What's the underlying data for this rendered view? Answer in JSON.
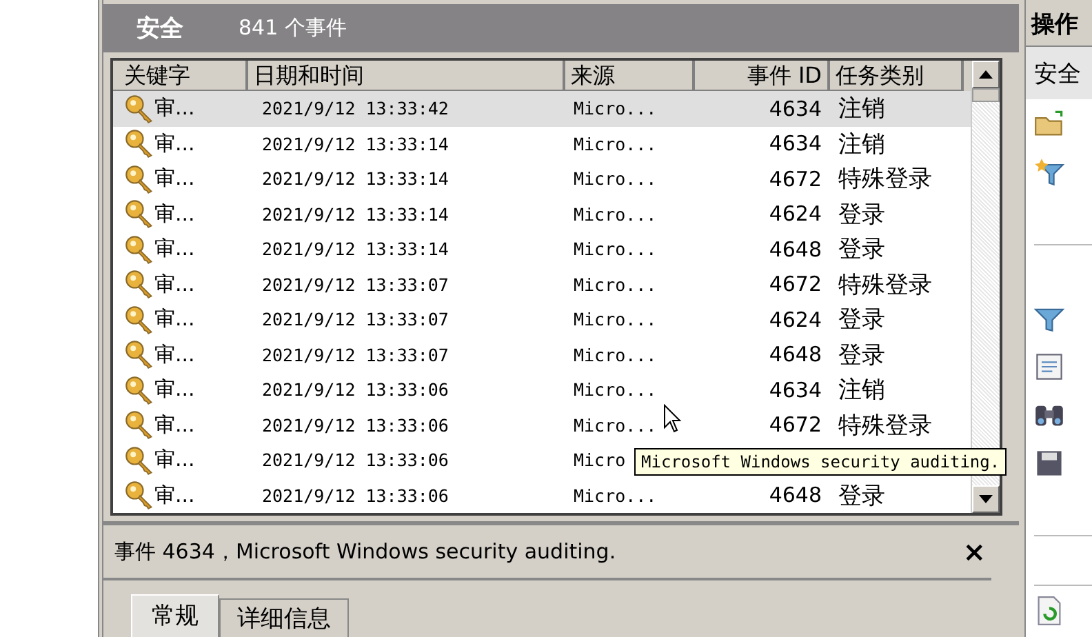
{
  "header": {
    "title": "安全",
    "count": "841 个事件"
  },
  "table": {
    "columns": [
      "关键字",
      "日期和时间",
      "来源",
      "事件 ID",
      "任务类别"
    ],
    "rows": [
      {
        "keyword": "审...",
        "datetime": "2021/9/12 13:33:42",
        "source": "Micro...",
        "event_id": "4634",
        "task": "注销",
        "selected": true
      },
      {
        "keyword": "审...",
        "datetime": "2021/9/12 13:33:14",
        "source": "Micro...",
        "event_id": "4634",
        "task": "注销",
        "selected": false
      },
      {
        "keyword": "审...",
        "datetime": "2021/9/12 13:33:14",
        "source": "Micro...",
        "event_id": "4672",
        "task": "特殊登录",
        "selected": false
      },
      {
        "keyword": "审...",
        "datetime": "2021/9/12 13:33:14",
        "source": "Micro...",
        "event_id": "4624",
        "task": "登录",
        "selected": false
      },
      {
        "keyword": "审...",
        "datetime": "2021/9/12 13:33:14",
        "source": "Micro...",
        "event_id": "4648",
        "task": "登录",
        "selected": false
      },
      {
        "keyword": "审...",
        "datetime": "2021/9/12 13:33:07",
        "source": "Micro...",
        "event_id": "4672",
        "task": "特殊登录",
        "selected": false
      },
      {
        "keyword": "审...",
        "datetime": "2021/9/12 13:33:07",
        "source": "Micro...",
        "event_id": "4624",
        "task": "登录",
        "selected": false
      },
      {
        "keyword": "审...",
        "datetime": "2021/9/12 13:33:07",
        "source": "Micro...",
        "event_id": "4648",
        "task": "登录",
        "selected": false
      },
      {
        "keyword": "审...",
        "datetime": "2021/9/12 13:33:06",
        "source": "Micro...",
        "event_id": "4634",
        "task": "注销",
        "selected": false
      },
      {
        "keyword": "审...",
        "datetime": "2021/9/12 13:33:06",
        "source": "Micro...",
        "event_id": "4672",
        "task": "特殊登录",
        "selected": false
      },
      {
        "keyword": "审...",
        "datetime": "2021/9/12 13:33:06",
        "source": "Micro",
        "event_id": "",
        "task": "",
        "selected": false
      },
      {
        "keyword": "审...",
        "datetime": "2021/9/12 13:33:06",
        "source": "Micro...",
        "event_id": "4648",
        "task": "登录",
        "selected": false
      }
    ]
  },
  "tooltip": "Microsoft Windows security auditing.",
  "details": {
    "title": "事件 4634，Microsoft Windows security auditing.",
    "close": "×",
    "tabs": [
      {
        "label": "常规",
        "selected": true
      },
      {
        "label": "详细信息",
        "selected": false
      }
    ]
  },
  "actions": {
    "title": "操作",
    "section": "安全",
    "items": [
      {
        "kind": "folder"
      },
      {
        "kind": "filter-star"
      },
      {
        "kind": "blank"
      },
      {
        "kind": "divider"
      },
      {
        "kind": "blank"
      },
      {
        "kind": "filter"
      },
      {
        "kind": "properties"
      },
      {
        "kind": "binoculars"
      },
      {
        "kind": "disk"
      },
      {
        "kind": "blank"
      },
      {
        "kind": "divider"
      },
      {
        "kind": "blank"
      },
      {
        "kind": "divider"
      },
      {
        "kind": "refresh"
      }
    ]
  }
}
